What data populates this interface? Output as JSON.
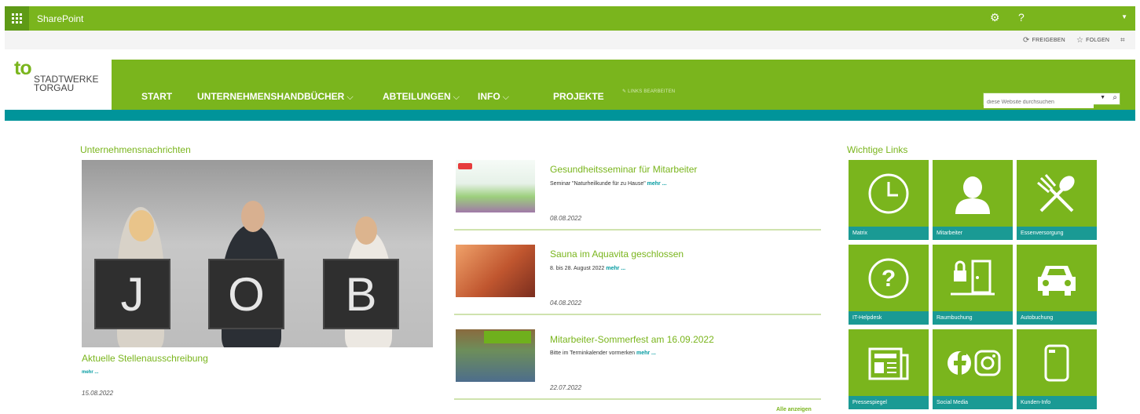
{
  "suitebar": {
    "app_name": "SharePoint",
    "settings_icon": "gear-icon",
    "help_label": "?"
  },
  "actionbar": {
    "share_label": "FREIGEBEN",
    "follow_label": "FOLGEN"
  },
  "logo": {
    "mark": "to",
    "line1": "STADTWERKE",
    "line2": "TORGAU"
  },
  "nav": {
    "items": [
      {
        "label": "START",
        "has_dropdown": false
      },
      {
        "label": "UNTERNEHMENSHANDBÜCHER",
        "has_dropdown": true
      },
      {
        "label": "ABTEILUNGEN",
        "has_dropdown": true
      },
      {
        "label": "INFO",
        "has_dropdown": true
      },
      {
        "label": "PROJEKTE",
        "has_dropdown": false
      }
    ],
    "edit_links_label": "LINKS BEARBEITEN",
    "search_placeholder": "diese Website durchsuchen"
  },
  "company_news": {
    "title": "Unternehmensnachrichten",
    "featured": {
      "board_letters": [
        "J",
        "O",
        "B"
      ],
      "headline": "Aktuelle Stellenausschreibung",
      "more": "mehr ...",
      "date": "15.08.2022"
    }
  },
  "news_list": {
    "items": [
      {
        "title": "Gesundheitsseminar für Mitarbeiter",
        "summary": "Seminar \"Naturheilkunde für zu Hause\"",
        "more": "mehr ...",
        "date": "08.08.2022"
      },
      {
        "title": "Sauna im Aquavita geschlossen",
        "summary": "8. bis 28. August 2022",
        "more": "mehr ...",
        "date": "04.08.2022"
      },
      {
        "title": "Mitarbeiter-Sommerfest am 16.09.2022",
        "summary": "Bitte im Terminkalender vormerken",
        "more": "mehr ...",
        "date": "22.07.2022"
      }
    ],
    "all_link": "Alle anzeigen"
  },
  "important_links": {
    "title": "Wichtige Links",
    "tiles": [
      {
        "label": "Matrix",
        "icon": "clock-icon"
      },
      {
        "label": "Mitarbeiter",
        "icon": "person-icon"
      },
      {
        "label": "Essenversorgung",
        "icon": "fork-spoon-icon"
      },
      {
        "label": "IT-Helpdesk",
        "icon": "question-icon"
      },
      {
        "label": "Raumbuchung",
        "icon": "door-lock-icon"
      },
      {
        "label": "Autobuchung",
        "icon": "car-icon"
      },
      {
        "label": "Pressespiegel",
        "icon": "newspaper-icon"
      },
      {
        "label": "Social Media",
        "icon": "social-media-icon"
      },
      {
        "label": "Kunden-Info",
        "icon": "card-icon"
      }
    ]
  },
  "colors": {
    "brand_green": "#7ab51d",
    "teal": "#00949a",
    "tile_caption": "#1a9a94"
  }
}
